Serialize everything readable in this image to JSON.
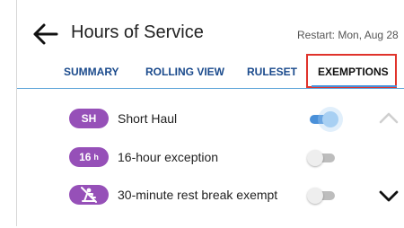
{
  "header": {
    "back_icon": "arrow-left-icon",
    "title": "Hours of Service",
    "restart": "Restart: Mon, Aug 28"
  },
  "tabs": [
    {
      "label": "SUMMARY",
      "active": false
    },
    {
      "label": "ROLLING VIEW",
      "active": false
    },
    {
      "label": "RULESET",
      "active": false
    },
    {
      "label": "EXEMPTIONS",
      "active": true
    }
  ],
  "exemptions": [
    {
      "badge": "SH",
      "label": "Short Haul",
      "enabled": true
    },
    {
      "badge": "16",
      "badge_unit": "h",
      "label": "16-hour exception",
      "enabled": false
    },
    {
      "badge_icon": "no-rest-break-icon",
      "label": "30-minute rest break exempt",
      "enabled": false
    }
  ],
  "colors": {
    "badge": "#9650b8",
    "tab_text": "#1a4a8c",
    "accent": "#4a90d9",
    "highlight": "#e0332b"
  },
  "icons": {
    "scroll_up": "chevron-up-icon",
    "scroll_down": "chevron-down-icon"
  }
}
